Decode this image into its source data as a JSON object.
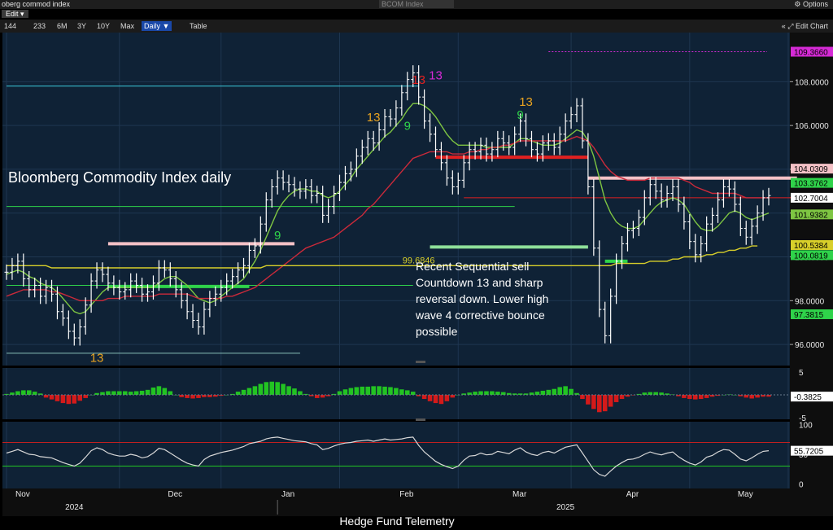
{
  "window": {
    "title": "oberg commod index",
    "ticker_field": "BCOM Index",
    "options_label": "Options",
    "edit_label": "Edit",
    "edit_chart_label": "Edit Chart"
  },
  "toolbar": {
    "ranges": [
      "144",
      "233",
      "6M",
      "3Y",
      "10Y",
      "Max"
    ],
    "period_label": "Daily ▼",
    "table_label": "Table"
  },
  "colors": {
    "panel_bg": "#0f2236",
    "price_bars": "#ffffff",
    "ma_fast": "#7ec542",
    "ma_mid": "#cc2a3a",
    "ma_slow": "#d8cf2a",
    "setup_green": "#2fd34a",
    "countdown_red": "#e02020",
    "magenta": "#d62ad6",
    "orange": "#e9a320",
    "macd_pos": "#22c422",
    "macd_neg": "#d41a1a",
    "rsi_line": "#d8d8d8"
  },
  "chart_data": [
    {
      "type": "line",
      "title": "Bloomberg Commodity Index daily",
      "ylim": [
        95,
        109.5
      ],
      "x_ticks": [
        "Nov",
        "Dec",
        "Jan",
        "Feb",
        "Mar",
        "Apr",
        "May"
      ],
      "x_years": [
        "2024",
        "2025"
      ],
      "y_ticks": [
        "108.0000",
        "106.0000",
        "104.0000",
        "102.0000",
        "100.0000",
        "98.0000",
        "96.0000"
      ],
      "axis_values": [
        {
          "label": "109.3660",
          "value": 109.37,
          "color": "#d62ad6"
        },
        {
          "label": "104.0309",
          "value": 104.03,
          "color": "#f4c1c6"
        },
        {
          "label": "103.3762",
          "value": 103.38,
          "color": "#2fd34a"
        },
        {
          "label": "102.7004",
          "value": 102.7,
          "color": "#ffffff"
        },
        {
          "label": "101.9382",
          "value": 101.94,
          "color": "#7ec542"
        },
        {
          "label": "100.5384",
          "value": 100.54,
          "color": "#d8cf2a"
        },
        {
          "label": "100.0819",
          "value": 100.08,
          "color": "#2fd34a"
        },
        {
          "label": "97.3815",
          "value": 97.38,
          "color": "#2fd34a"
        }
      ],
      "series": [
        {
          "values": [
            99.3,
            99.6,
            99.8,
            99.0,
            98.5,
            98.7,
            98.2,
            98.6,
            98.3,
            97.5,
            97.2,
            96.6,
            96.3,
            96.8,
            97.8,
            98.9,
            99.4,
            99.2,
            98.8,
            98.6,
            98.4,
            98.5,
            98.9,
            98.7,
            98.3,
            98.4,
            98.8,
            99.5,
            99.4,
            99.0,
            98.5,
            98.0,
            97.5,
            97.1,
            96.8,
            97.6,
            98.1,
            98.3,
            98.6,
            98.9,
            99.1,
            99.4,
            99.6,
            100.3,
            100.5,
            101.5,
            102.6,
            103.2,
            103.6,
            103.4,
            103.3,
            103.1,
            103.0,
            103.2,
            102.8,
            102.9,
            101.9,
            102.3,
            102.9,
            103.4,
            103.8,
            104.0,
            104.6,
            105.0,
            105.4,
            105.2,
            105.8,
            106.4,
            106.3,
            106.8,
            107.5,
            108.1,
            108.4,
            107.3,
            106.2,
            105.6,
            104.9,
            104.3,
            103.6,
            103.2,
            103.5,
            104.3,
            104.9,
            104.8,
            105.1,
            104.7,
            104.9,
            105.4,
            105.2,
            105.0,
            105.6,
            106.2,
            105.4,
            104.9,
            104.7,
            105.2,
            105.3,
            105.0,
            105.6,
            106.2,
            106.5,
            106.9,
            105.3,
            103.2,
            100.4,
            97.6,
            96.4,
            98.2,
            99.8,
            100.6,
            101.2,
            101.3,
            101.8,
            102.7,
            103.3,
            103.0,
            102.6,
            102.9,
            103.2,
            102.4,
            101.6,
            100.7,
            100.1,
            100.6,
            101.5,
            101.9,
            102.6,
            103.2,
            103.1,
            102.4,
            101.3,
            100.9,
            101.4,
            102.0,
            102.7,
            102.8
          ]
        },
        {
          "values": [
            99.2,
            99.3,
            99.4,
            99.3,
            99.1,
            99.0,
            98.8,
            98.7,
            98.6,
            98.4,
            98.1,
            97.8,
            97.5,
            97.4,
            97.5,
            97.8,
            98.1,
            98.4,
            98.6,
            98.6,
            98.6,
            98.6,
            98.6,
            98.6,
            98.6,
            98.6,
            98.6,
            98.8,
            99.0,
            99.1,
            99.1,
            98.9,
            98.7,
            98.4,
            98.1,
            98.0,
            97.9,
            98.0,
            98.2,
            98.4,
            98.6,
            98.8,
            99.0,
            99.4,
            99.8,
            100.3,
            100.9,
            101.5,
            102.1,
            102.5,
            102.8,
            103.0,
            103.1,
            103.1,
            103.0,
            103.0,
            102.8,
            102.7,
            102.8,
            103.0,
            103.3,
            103.6,
            104.0,
            104.3,
            104.6,
            104.9,
            105.2,
            105.5,
            105.7,
            106.0,
            106.3,
            106.7,
            107.0,
            107.0,
            106.9,
            106.7,
            106.4,
            106.0,
            105.6,
            105.3,
            105.1,
            105.1,
            105.1,
            105.1,
            105.1,
            105.0,
            105.0,
            105.0,
            105.0,
            105.0,
            105.2,
            105.4,
            105.4,
            105.3,
            105.2,
            105.1,
            105.1,
            105.1,
            105.2,
            105.4,
            105.6,
            105.8,
            105.7,
            105.3,
            104.6,
            103.6,
            102.6,
            102.0,
            101.6,
            101.4,
            101.3,
            101.3,
            101.4,
            101.7,
            102.0,
            102.3,
            102.5,
            102.6,
            102.7,
            102.6,
            102.4,
            102.0,
            101.6,
            101.3,
            101.2,
            101.2,
            101.4,
            101.7,
            102.0,
            102.1,
            102.0,
            101.8,
            101.7,
            101.8,
            101.9,
            102.0
          ]
        },
        {
          "values": [
            98.2,
            98.3,
            98.4,
            98.5,
            98.5,
            98.5,
            98.5,
            98.5,
            98.4,
            98.4,
            98.3,
            98.2,
            98.1,
            98.0,
            98.0,
            98.0,
            98.0,
            98.0,
            98.1,
            98.1,
            98.1,
            98.2,
            98.2,
            98.2,
            98.2,
            98.2,
            98.2,
            98.3,
            98.3,
            98.3,
            98.3,
            98.3,
            98.3,
            98.2,
            98.1,
            98.1,
            98.1,
            98.1,
            98.1,
            98.2,
            98.2,
            98.3,
            98.4,
            98.5,
            98.6,
            98.8,
            99.0,
            99.2,
            99.4,
            99.6,
            99.8,
            100.0,
            100.2,
            100.4,
            100.5,
            100.6,
            100.7,
            100.8,
            100.9,
            101.1,
            101.3,
            101.5,
            101.7,
            101.9,
            102.2,
            102.4,
            102.7,
            103.0,
            103.3,
            103.6,
            103.9,
            104.2,
            104.5,
            104.6,
            104.7,
            104.8,
            104.8,
            104.8,
            104.8,
            104.7,
            104.7,
            104.7,
            104.8,
            104.8,
            104.9,
            104.9,
            105.0,
            105.0,
            105.1,
            105.1,
            105.2,
            105.3,
            105.3,
            105.3,
            105.3,
            105.3,
            105.3,
            105.3,
            105.3,
            105.3,
            105.4,
            105.5,
            105.4,
            105.3,
            105.0,
            104.6,
            104.2,
            103.9,
            103.7,
            103.6,
            103.5,
            103.5,
            103.5,
            103.5,
            103.6,
            103.6,
            103.6,
            103.6,
            103.6,
            103.6,
            103.5,
            103.4,
            103.2,
            103.1,
            103.0,
            102.9,
            102.9,
            102.9,
            102.9,
            102.9,
            102.8,
            102.7,
            102.7,
            102.7,
            102.7,
            102.7
          ]
        },
        {
          "values": [
            99.6,
            99.6,
            99.6,
            99.6,
            99.6,
            99.6,
            99.6,
            99.6,
            99.5,
            99.5,
            99.5,
            99.5,
            99.5,
            99.5,
            99.5,
            99.5,
            99.5,
            99.5,
            99.5,
            99.5,
            99.5,
            99.5,
            99.5,
            99.5,
            99.5,
            99.5,
            99.5,
            99.5,
            99.5,
            99.5,
            99.5,
            99.5,
            99.5,
            99.5,
            99.5,
            99.5,
            99.5,
            99.5,
            99.5,
            99.5,
            99.5,
            99.5,
            99.5,
            99.5,
            99.5,
            99.5,
            99.6,
            99.6,
            99.6,
            99.6,
            99.6,
            99.6,
            99.6,
            99.6,
            99.6,
            99.6,
            99.6,
            99.6,
            99.6,
            99.6,
            99.6,
            99.6,
            99.6,
            99.6,
            99.6,
            99.6,
            99.6,
            99.6,
            99.6,
            99.6,
            99.6,
            99.6,
            99.6,
            99.6,
            99.6,
            99.6,
            99.6,
            99.6,
            99.6,
            99.6,
            99.6,
            99.6,
            99.6,
            99.6,
            99.6,
            99.6,
            99.6,
            99.6,
            99.6,
            99.6,
            99.6,
            99.6,
            99.6,
            99.6,
            99.6,
            99.6,
            99.6,
            99.6,
            99.6,
            99.6,
            99.6,
            99.6,
            99.6,
            99.6,
            99.6,
            99.6,
            99.6,
            99.6,
            99.7,
            99.7,
            99.7,
            99.7,
            99.7,
            99.7,
            99.8,
            99.8,
            99.8,
            99.8,
            99.9,
            99.9,
            100.0,
            100.0,
            100.0,
            100.0,
            100.1,
            100.1,
            100.2,
            100.2,
            100.3,
            100.3,
            100.4,
            100.4,
            100.5,
            100.5
          ]
        }
      ],
      "levels": [
        {
          "value": 107.8,
          "i0": 0,
          "i1": 73,
          "color": "#3ac6d8",
          "width": 1
        },
        {
          "value": 100.6,
          "i0": 18,
          "i1": 51,
          "color": "#f4c1c6",
          "width": 4
        },
        {
          "value": 98.65,
          "i0": 18,
          "i1": 43,
          "color": "#2fd34a",
          "width": 4
        },
        {
          "value": 95.6,
          "i0": 0,
          "i1": 52,
          "color": "#88c0b8",
          "width": 1
        },
        {
          "value": 103.6,
          "i0": 103,
          "i1": 140,
          "color": "#f4c1c6",
          "width": 4
        },
        {
          "value": 104.55,
          "i0": 76,
          "i1": 103,
          "color": "#e02020",
          "width": 4
        },
        {
          "value": 100.45,
          "i0": 75,
          "i1": 103,
          "color": "#8fe09a",
          "width": 4
        },
        {
          "value": 99.8,
          "i0": 106,
          "i1": 110,
          "color": "#2fd34a",
          "width": 4
        },
        {
          "value": 102.3,
          "i0": 0,
          "i1": 90,
          "color": "#2fd34a",
          "width": 1
        },
        {
          "value": 98.7,
          "i0": 0,
          "i1": 72,
          "color": "#2fd34a",
          "width": 1
        },
        {
          "value": 102.7,
          "i0": 81,
          "i1": 140,
          "color": "#e02020",
          "width": 1
        }
      ],
      "annotations": [
        {
          "text": "99.6846",
          "i": 73,
          "y": 99.7,
          "color": "#d8cf2a"
        },
        {
          "text": "13",
          "i": 16,
          "y": 95.2,
          "color": "#e9a320"
        },
        {
          "text": "13",
          "i": 65,
          "y": 106.2,
          "color": "#e9a320"
        },
        {
          "text": "13",
          "i": 92,
          "y": 106.9,
          "color": "#e9a320"
        },
        {
          "text": "13",
          "i": 76,
          "y": 108.1,
          "color": "#d62ad6"
        },
        {
          "text": "13",
          "i": 73,
          "y": 107.9,
          "color": "#e02020"
        },
        {
          "text": "9",
          "i": 71,
          "y": 105.8,
          "color": "#2fd34a"
        },
        {
          "text": "9",
          "i": 91,
          "y": 106.3,
          "color": "#2fd34a"
        },
        {
          "text": "9",
          "i": 48,
          "y": 100.8,
          "color": "#2fd34a"
        }
      ],
      "notes": [
        "Recent Sequential sell",
        "Countdown 13 and sharp",
        "reversal down.  Lower high",
        "wave 4 corrective bounce",
        "possible"
      ]
    },
    {
      "type": "bar",
      "ylim": [
        -5,
        5
      ],
      "y_ticks": [
        "5",
        "0",
        "-5"
      ],
      "current": "-0.3825",
      "values": [
        0.2,
        0.5,
        0.8,
        1.0,
        1.0,
        0.7,
        0.3,
        -0.6,
        -1.0,
        -1.4,
        -1.8,
        -2.0,
        -1.9,
        -1.3,
        -0.7,
        0.0,
        0.4,
        0.6,
        0.8,
        0.8,
        0.8,
        0.8,
        0.7,
        0.8,
        0.9,
        1.1,
        1.6,
        1.9,
        1.5,
        0.8,
        0.0,
        -0.5,
        -0.7,
        -0.8,
        -0.7,
        -0.5,
        -0.5,
        -0.4,
        -0.2,
        0.0,
        0.2,
        0.7,
        1.1,
        1.5,
        1.9,
        2.4,
        2.8,
        2.9,
        2.8,
        2.4,
        1.9,
        1.4,
        0.8,
        0.2,
        -0.3,
        -0.7,
        -0.6,
        -0.3,
        0.2,
        0.8,
        1.2,
        1.5,
        1.7,
        1.8,
        1.8,
        1.9,
        1.9,
        1.8,
        1.7,
        1.5,
        1.2,
        1.0,
        0.7,
        -0.3,
        -0.9,
        -1.4,
        -1.8,
        -2.0,
        -1.4,
        -0.6,
        0.0,
        0.3,
        0.5,
        0.7,
        0.8,
        0.8,
        0.8,
        0.7,
        0.6,
        0.4,
        0.3,
        0.3,
        0.3,
        0.5,
        0.7,
        0.9,
        1.1,
        1.3,
        1.7,
        1.9,
        1.3,
        0.4,
        -0.9,
        -2.1,
        -3.1,
        -3.8,
        -3.6,
        -2.6,
        -1.6,
        -0.9,
        -0.4,
        -0.1,
        0.2,
        0.5,
        0.6,
        0.6,
        0.5,
        0.3,
        0.1,
        -0.3,
        -0.7,
        -0.9,
        -1.0,
        -0.9,
        -0.7,
        -0.4,
        -0.2,
        0.0,
        0.1,
        0.0,
        -0.3,
        -0.6,
        -0.8,
        -0.6,
        -0.4,
        -0.4
      ]
    },
    {
      "type": "line",
      "ylim": [
        -5,
        105
      ],
      "y_ticks": [
        "100",
        "50",
        "0"
      ],
      "current": "55.7205",
      "bands": [
        30,
        70
      ],
      "values": [
        52,
        55,
        58,
        54,
        50,
        49,
        46,
        45,
        44,
        40,
        36,
        33,
        30,
        35,
        45,
        56,
        61,
        58,
        52,
        49,
        47,
        47,
        50,
        48,
        44,
        46,
        52,
        60,
        58,
        52,
        46,
        40,
        35,
        32,
        30,
        41,
        47,
        50,
        53,
        55,
        57,
        60,
        63,
        68,
        70,
        72,
        76,
        78,
        79,
        77,
        75,
        73,
        72,
        71,
        68,
        66,
        58,
        60,
        64,
        67,
        69,
        70,
        72,
        73,
        74,
        72,
        74,
        76,
        74,
        75,
        76,
        78,
        79,
        65,
        54,
        46,
        38,
        33,
        29,
        26,
        30,
        40,
        47,
        48,
        52,
        49,
        50,
        55,
        53,
        51,
        57,
        61,
        54,
        50,
        48,
        53,
        55,
        52,
        57,
        62,
        64,
        66,
        52,
        38,
        24,
        16,
        13,
        22,
        30,
        36,
        41,
        42,
        45,
        50,
        54,
        51,
        49,
        52,
        54,
        46,
        40,
        35,
        32,
        37,
        45,
        48,
        54,
        58,
        57,
        50,
        42,
        39,
        44,
        50,
        55,
        56
      ]
    }
  ],
  "footer": {
    "caption": "Hedge Fund Telemetry"
  }
}
